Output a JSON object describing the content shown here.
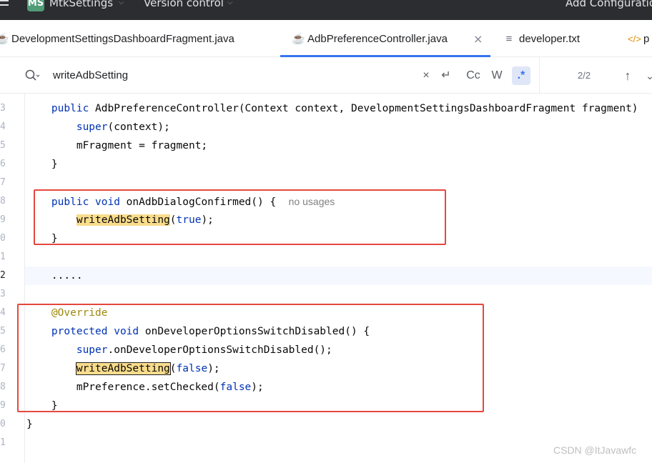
{
  "titlebar": {
    "project_badge": "MS",
    "project_name": "MtkSettings",
    "vcs": "Version control",
    "add_configuration": "Add Configuratio"
  },
  "tabs": [
    {
      "label": "DevelopmentSettingsDashboardFragment.java",
      "icon": "java-class-icon",
      "active": false
    },
    {
      "label": "AdbPreferenceController.java",
      "icon": "java-class-icon",
      "active": true
    },
    {
      "label": "developer.txt",
      "icon": "text-file-icon",
      "active": false
    },
    {
      "label": "p",
      "icon": "html-file-icon",
      "active": false
    }
  ],
  "find": {
    "query": "writeAdbSetting",
    "match_case": "Cc",
    "words": "W",
    "regex": ".*",
    "match_count": "2/2"
  },
  "editor": {
    "line_numbers": [
      "3",
      "4",
      "5",
      "6",
      "7",
      "8",
      "9",
      "0",
      "1",
      "2",
      "3",
      "4",
      "5",
      "6",
      "7",
      "8",
      "9",
      "0",
      "1"
    ],
    "inlay_hint": "no usages",
    "search_match": "writeAdbSetting"
  },
  "watermark": "CSDN @ItJavawfc",
  "colors": {
    "keyword": "#0033b3",
    "annotation": "#9e880d",
    "search_highlight": "#f9dc8c",
    "annotation_box": "#e5483d",
    "accent": "#3574f0"
  }
}
